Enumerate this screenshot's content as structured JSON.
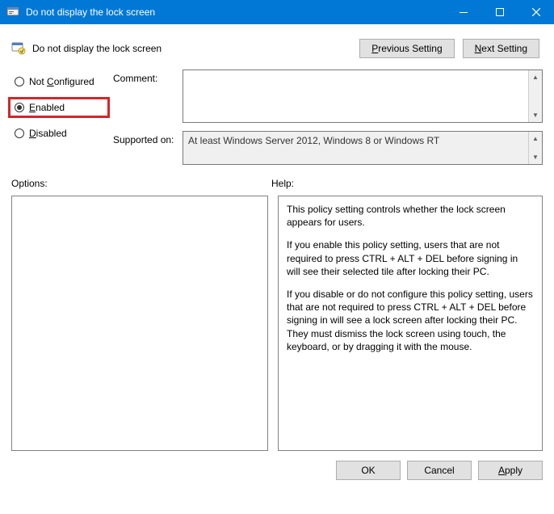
{
  "window": {
    "title": "Do not display the lock screen"
  },
  "header": {
    "policy_title": "Do not display the lock screen",
    "previous_prefix": "P",
    "previous_rest": "revious Setting",
    "next_prefix": "N",
    "next_rest": "ext Setting"
  },
  "state": {
    "not_configured_prefix": "C",
    "not_configured_pre": "Not ",
    "not_configured_rest": "onfigured",
    "enabled_prefix": "E",
    "enabled_rest": "nabled",
    "disabled_prefix": "D",
    "disabled_rest": "isabled",
    "selected": "enabled"
  },
  "fields": {
    "comment_label": "Comment:",
    "comment_value": "",
    "supported_label": "Supported on:",
    "supported_value": "At least Windows Server 2012, Windows 8 or Windows RT"
  },
  "lower": {
    "options_label": "Options:",
    "help_label": "Help:",
    "help_p1": "This policy setting controls whether the lock screen appears for users.",
    "help_p2": "If you enable this policy setting, users that are not required to press CTRL + ALT + DEL before signing in will see their selected tile after locking their PC.",
    "help_p3": "If you disable or do not configure this policy setting, users that are not required to press CTRL + ALT + DEL before signing in will see a lock screen after locking their PC. They must dismiss the lock screen using touch, the keyboard, or by dragging it with the mouse."
  },
  "footer": {
    "ok": "OK",
    "cancel": "Cancel",
    "apply_prefix": "A",
    "apply_rest": "pply"
  }
}
